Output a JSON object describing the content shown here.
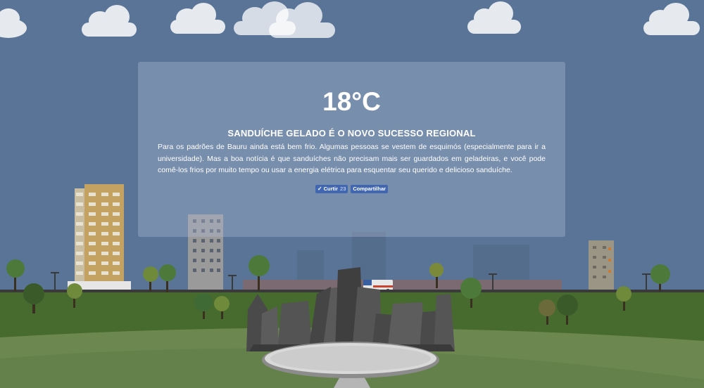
{
  "weather": {
    "temperature": "18°C"
  },
  "news": {
    "headline": "SANDUÍCHE GELADO É O NOVO SUCESSO REGIONAL",
    "body": "Para os padrões de Bauru ainda está bem frio. Algumas pessoas se vestem de esquimós (especialmente para ir a universidade). Mas a boa notícia é que sanduíches não precisam mais ser guardados em geladeiras, e você pode comê-los frios por muito tempo ou usar a energia elétrica para esquentar seu querido e delicioso sanduíche."
  },
  "social": {
    "like_label": "Curtir",
    "like_count": "23",
    "share_label": "Compartilhar"
  },
  "colors": {
    "sky": "#5a7497",
    "grass_dark": "#476a2e",
    "grass_light": "#6d8750",
    "button": "#4267b2"
  }
}
